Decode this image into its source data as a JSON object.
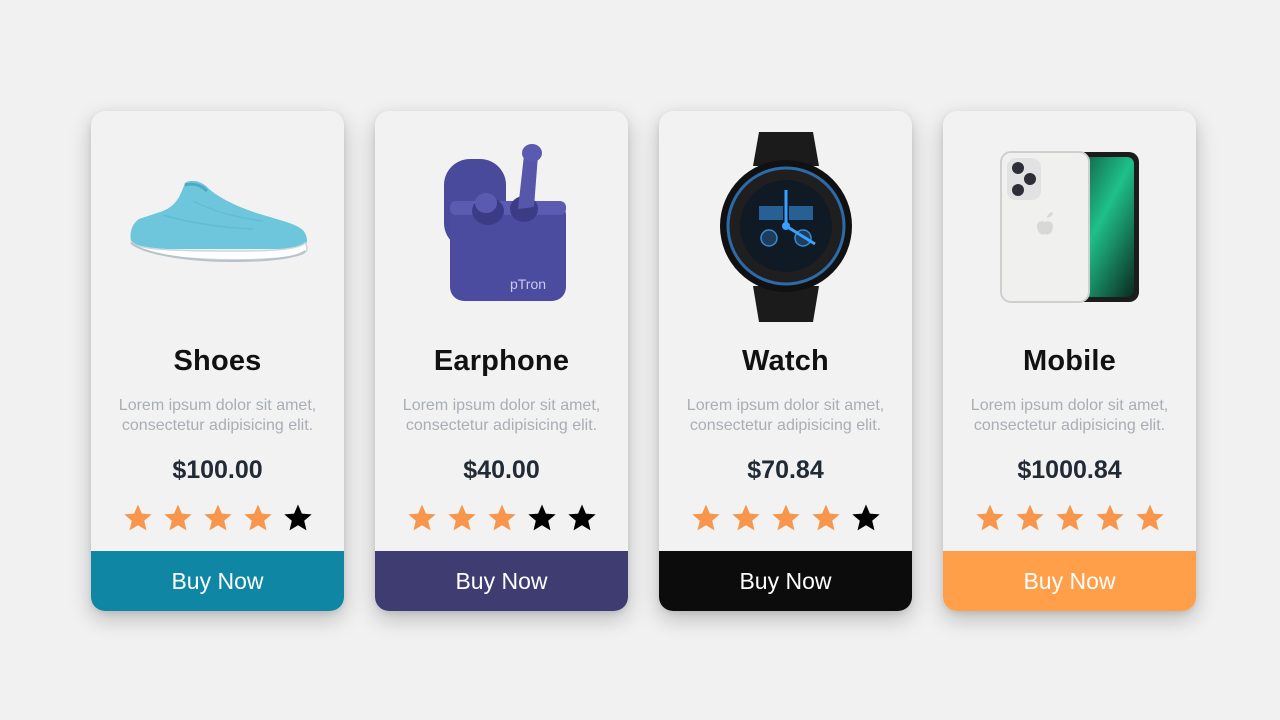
{
  "products": [
    {
      "name": "Shoes",
      "image_icon": "sneaker-icon",
      "description": "Lorem ipsum dolor sit amet, consectetur adipisicing elit.",
      "price": "$100.00",
      "rating": 4,
      "button_label": "Buy Now",
      "button_color": "#0f87a4"
    },
    {
      "name": "Earphone",
      "image_icon": "earbuds-case-icon",
      "description": "Lorem ipsum dolor sit amet, consectetur adipisicing elit.",
      "price": "$40.00",
      "rating": 3,
      "button_label": "Buy Now",
      "button_color": "#3f3c72"
    },
    {
      "name": "Watch",
      "image_icon": "wristwatch-icon",
      "description": "Lorem ipsum dolor sit amet, consectetur adipisicing elit.",
      "price": "$70.84",
      "rating": 4,
      "button_label": "Buy Now",
      "button_color": "#0c0c0c"
    },
    {
      "name": "Mobile",
      "image_icon": "smartphone-icon",
      "description": "Lorem ipsum dolor sit amet, consectetur adipisicing elit.",
      "price": "$1000.84",
      "rating": 5,
      "button_label": "Buy Now",
      "button_color": "#ff9f4a"
    }
  ],
  "rating_max": 5,
  "colors": {
    "star_filled": "#f7964c",
    "star_empty": "#000000",
    "background": "#f1f1f1"
  },
  "earbuds_case_brand": "pTron"
}
